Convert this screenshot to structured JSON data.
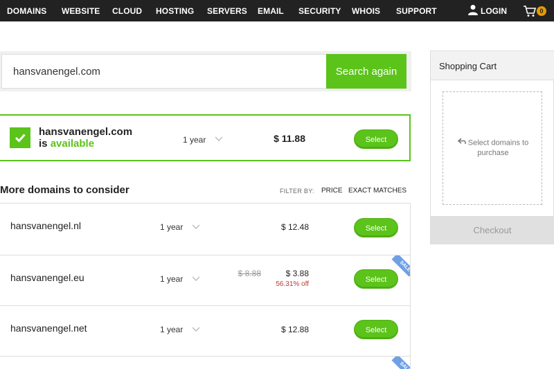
{
  "nav": {
    "items": [
      "DOMAINS",
      "WEBSITE",
      "CLOUD",
      "HOSTING",
      "SERVERS",
      "EMAIL",
      "SECURITY",
      "WHOIS",
      "SUPPORT"
    ],
    "login": "LOGIN",
    "cart_count": "0",
    "icons": {
      "login": "user-icon",
      "cart": "cart-icon"
    }
  },
  "search": {
    "value": "hansvanengel.com",
    "button": "Search again"
  },
  "available": {
    "domain": "hansvanengel.com",
    "is": "is",
    "status": "available",
    "term": "1 year",
    "price": "$ 11.88",
    "select": "Select"
  },
  "more": {
    "title": "More domains to consider",
    "filter_label": "FILTER BY:",
    "filters": [
      "PRICE",
      "EXACT MATCHES"
    ],
    "rows": [
      {
        "domain": "hansvanengel.nl",
        "term": "1 year",
        "price": "$ 12.48",
        "old_price": "",
        "discount": "",
        "sale": false,
        "select": "Select"
      },
      {
        "domain": "hansvanengel.eu",
        "term": "1 year",
        "price": "$ 3.88",
        "old_price": "$ 8.88",
        "discount": "56.31% off",
        "sale": true,
        "sale_label": "SALE",
        "select": "Select"
      },
      {
        "domain": "hansvanengel.net",
        "term": "1 year",
        "price": "$ 12.88",
        "old_price": "",
        "discount": "",
        "sale": false,
        "select": "Select"
      },
      {
        "domain": "",
        "sale": true,
        "sale_label": "SALE"
      }
    ]
  },
  "cart": {
    "title": "Shopping Cart",
    "hint": "Select domains to purchase",
    "checkout": "Checkout"
  },
  "colors": {
    "accent": "#5bc31a",
    "nav_bg": "#222222",
    "badge": "#e69b00",
    "sale": "#6fa0e6",
    "discount": "#c0392b"
  }
}
